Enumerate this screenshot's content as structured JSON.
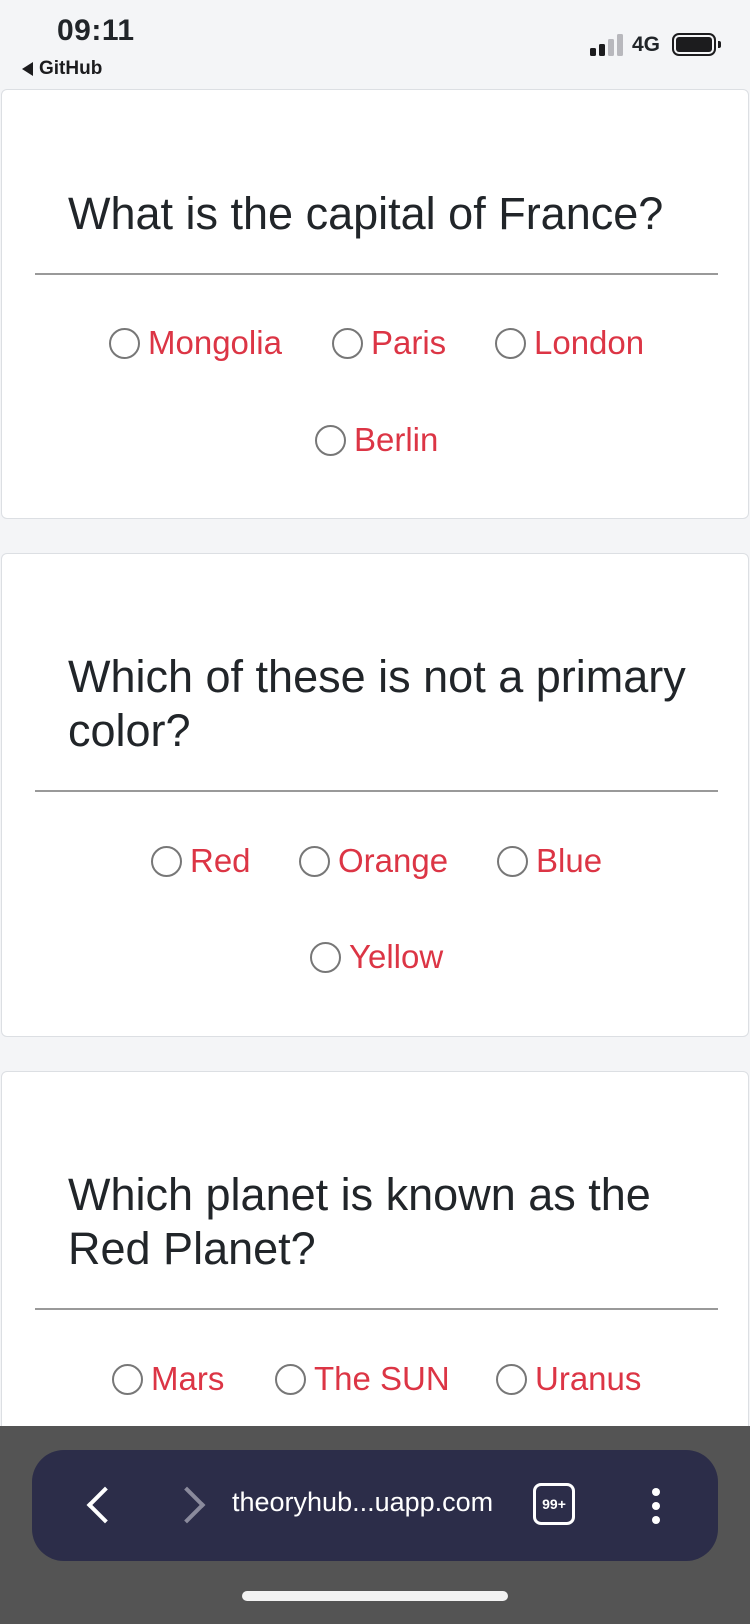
{
  "status_bar": {
    "time": "09:11",
    "back_app": "GitHub",
    "network": "4G"
  },
  "questions": [
    {
      "title": "What is the capital of France?",
      "options": [
        "Mongolia",
        "Paris",
        "London",
        "Berlin"
      ]
    },
    {
      "title": "Which of these is not a primary color?",
      "options": [
        "Red",
        "Orange",
        "Blue",
        "Yellow"
      ]
    },
    {
      "title": "Which planet is known as the Red Planet?",
      "options": [
        "Mars",
        "The SUN",
        "Uranus"
      ]
    }
  ],
  "browser": {
    "url": "theoryhub...uapp.com",
    "tab_count": "99+"
  },
  "colors": {
    "option_text": "#dc3545",
    "browser_bar": "#2c2d49"
  }
}
